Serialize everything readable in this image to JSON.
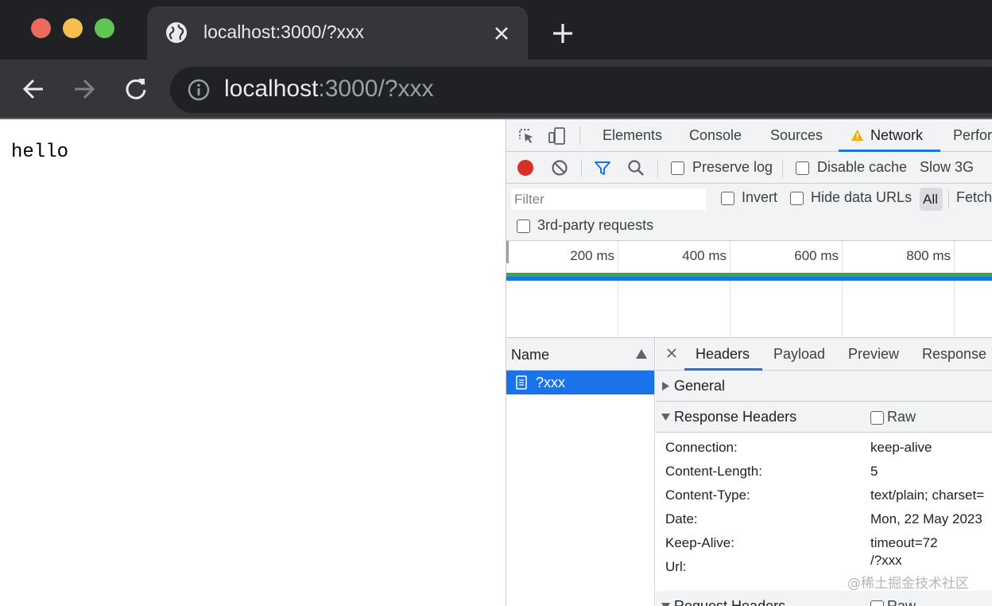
{
  "browser": {
    "tab_title": "localhost:3000/?xxx",
    "url_host": "localhost",
    "url_rest": ":3000/?xxx"
  },
  "page": {
    "body_text": "hello"
  },
  "devtools": {
    "tabs": [
      "Elements",
      "Console",
      "Sources",
      "Network",
      "Perfor"
    ],
    "active_tab": "Network",
    "toolbar": {
      "preserve_log": "Preserve log",
      "disable_cache": "Disable cache",
      "throttling": "Slow 3G"
    },
    "filter": {
      "placeholder": "Filter",
      "invert": "Invert",
      "hide_data_urls": "Hide data URLs",
      "all": "All",
      "fetch": "Fetch",
      "third_party": "3rd-party requests"
    },
    "timeline": {
      "ticks": [
        "200 ms",
        "400 ms",
        "600 ms",
        "800 ms"
      ]
    },
    "requests": {
      "name_header": "Name",
      "rows": [
        {
          "name": "?xxx",
          "selected": true
        }
      ]
    },
    "detail": {
      "tabs": [
        "Headers",
        "Payload",
        "Preview",
        "Response"
      ],
      "active_tab": "Headers",
      "sections": {
        "general": "General",
        "response_headers": "Response Headers",
        "request_headers": "Request Headers",
        "raw": "Raw"
      },
      "response_headers": [
        {
          "key": "Connection:",
          "value": "keep-alive"
        },
        {
          "key": "Content-Length:",
          "value": "5"
        },
        {
          "key": "Content-Type:",
          "value": "text/plain; charset="
        },
        {
          "key": "Date:",
          "value": "Mon, 22 May 2023"
        },
        {
          "key": "Keep-Alive:",
          "value": "timeout=72"
        },
        {
          "key": "Url:",
          "value": "/?xxx"
        }
      ]
    }
  },
  "watermark": "@稀土掘金技术社区",
  "colors": {
    "accent": "#1a73e8",
    "record": "#d93025",
    "warning": "#f9ab00",
    "tabstrip": "#202124",
    "toolbar": "#35363a"
  }
}
